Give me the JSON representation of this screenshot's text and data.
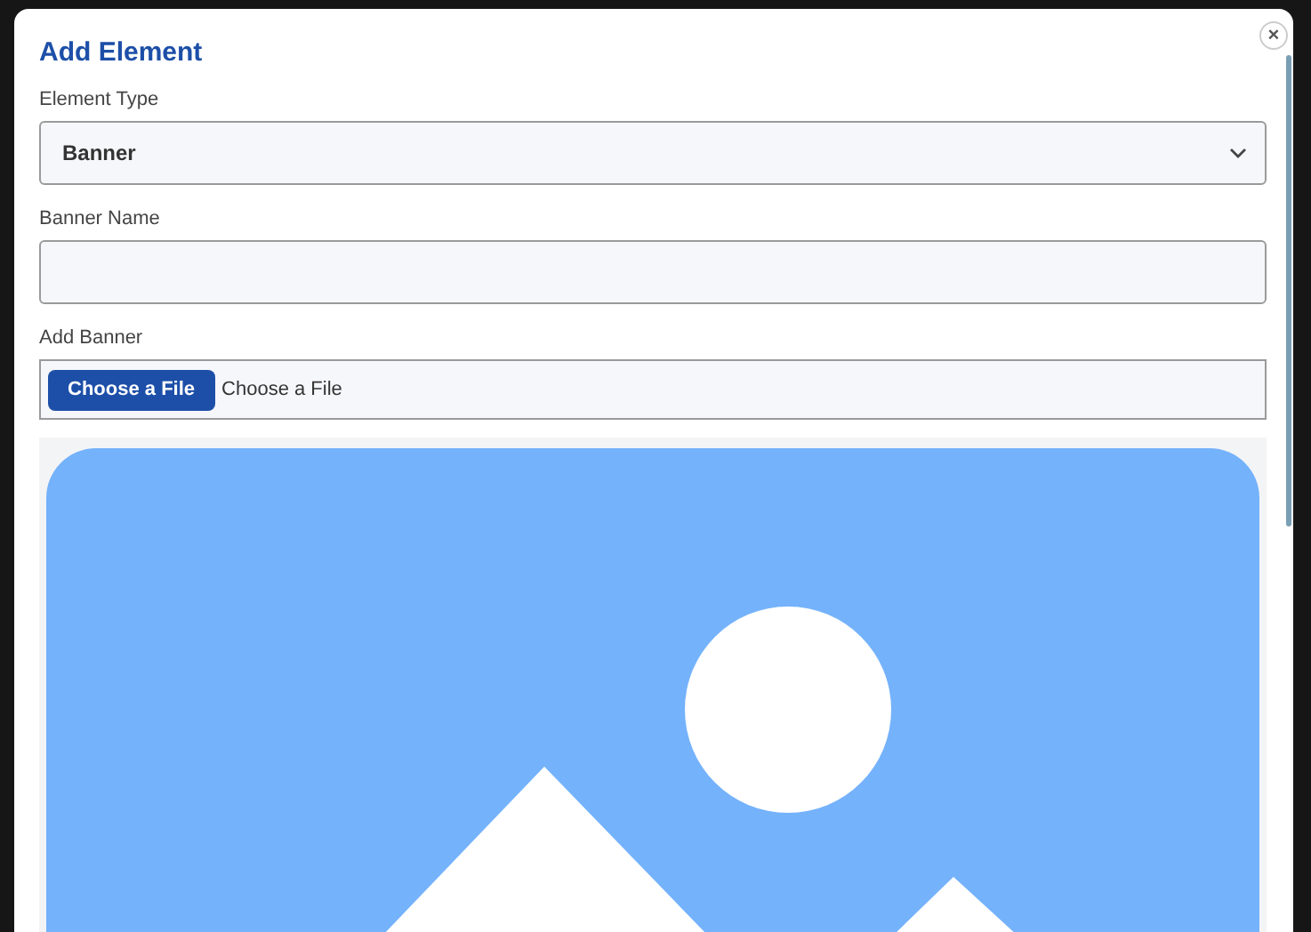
{
  "dialog": {
    "title": "Add Element",
    "close_label": "×"
  },
  "fields": [
    {
      "kind": "select",
      "label": "Element Type",
      "value": "Banner"
    },
    {
      "kind": "text",
      "label": "Banner Name"
    },
    {
      "kind": "file",
      "label": "Add Banner",
      "button": "Choose a File",
      "value": "Choose a File"
    }
  ]
}
